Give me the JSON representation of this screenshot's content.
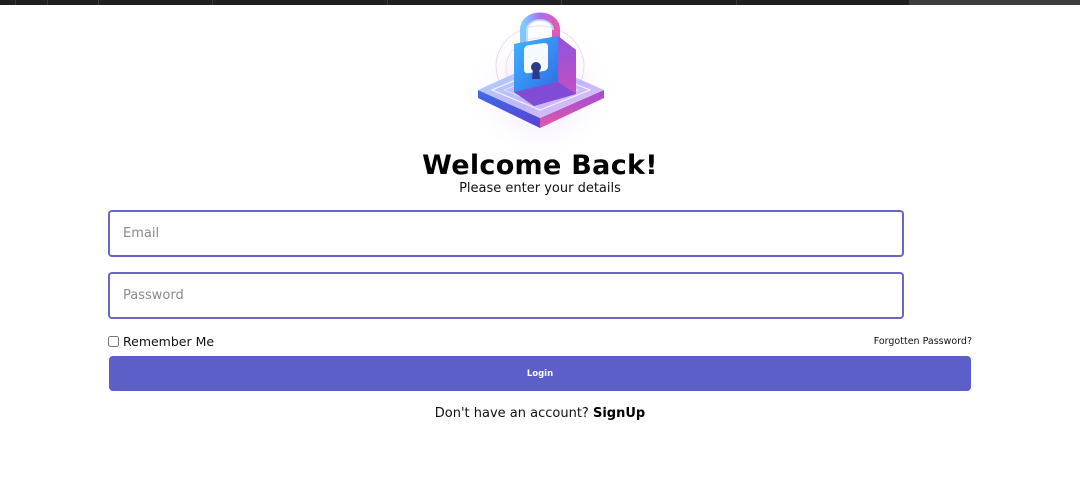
{
  "header": {
    "title": "Welcome Back!",
    "subtitle": "Please enter your details"
  },
  "illustration": {
    "icon": "padlock-on-platform-icon",
    "colors": {
      "accent_blue": "#3f7bea",
      "accent_purple": "#9b4bd8",
      "accent_pink": "#e45aa8"
    }
  },
  "form": {
    "email": {
      "placeholder": "Email",
      "value": ""
    },
    "password": {
      "placeholder": "Password",
      "value": ""
    },
    "remember_label": "Remember Me",
    "remember_checked": false,
    "forgot_label": "Forgotten Password?",
    "login_label": "Login"
  },
  "footer": {
    "prompt": "Don't have an account?",
    "signup_label": "SignUp"
  },
  "theme": {
    "primary": "#5b5fc7",
    "field_border": "#6a64c8"
  }
}
